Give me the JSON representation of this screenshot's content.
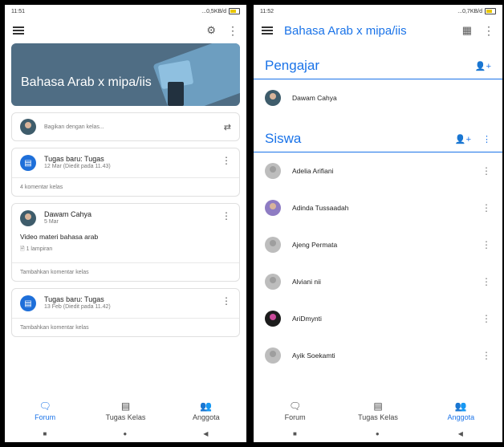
{
  "left": {
    "status": {
      "time": "11:51",
      "speed": "...0,5KB/d"
    },
    "class_title": "Bahasa Arab x mipa/iis",
    "share_placeholder": "Bagikan dengan kelas...",
    "posts": [
      {
        "title": "Tugas baru: Tugas",
        "subtitle": "12 Mar (Diedit pada 11.43)",
        "footer": "4 komentar kelas"
      },
      {
        "author": "Dawam Cahya",
        "date": "5 Mar",
        "text": "Video materi bahasa arab",
        "attachment": "1 lampiran",
        "footer": "Tambahkan komentar kelas"
      },
      {
        "title": "Tugas baru: Tugas",
        "subtitle": "13 Feb (Diedit pada 11.42)",
        "footer": "Tambahkan komentar kelas"
      }
    ],
    "nav": {
      "forum": "Forum",
      "tugas": "Tugas Kelas",
      "anggota": "Anggota"
    }
  },
  "right": {
    "status": {
      "time": "11:52",
      "speed": "...0,7KB/d"
    },
    "class_title": "Bahasa Arab x mipa/iis",
    "teachers_title": "Pengajar",
    "teachers": [
      "Dawam Cahya"
    ],
    "students_title": "Siswa",
    "students": [
      "Adelia Arifiani",
      "Adinda Tussaadah",
      "Ajeng Permata",
      "Alviani nii",
      "AriDmynti",
      "Ayik Soekamti"
    ],
    "nav": {
      "forum": "Forum",
      "tugas": "Tugas Kelas",
      "anggota": "Anggota"
    }
  },
  "colors": {
    "accent": "#1a73e8",
    "banner": "#4f6d84"
  }
}
